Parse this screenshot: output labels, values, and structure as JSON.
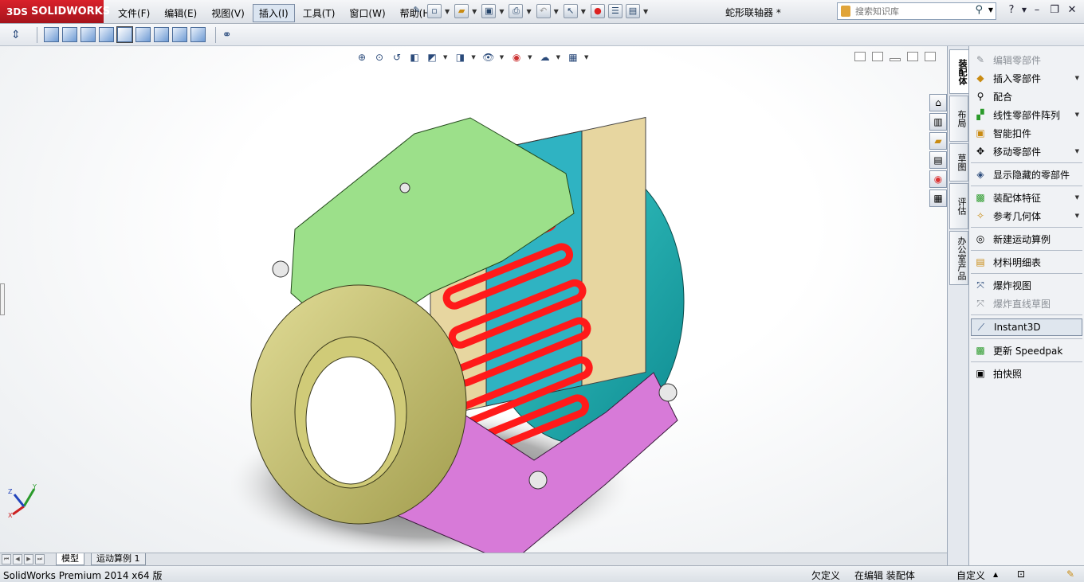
{
  "app": {
    "logo_ds": "3DS",
    "logo_text": "SOLIDWORKS",
    "document_title": "蛇形联轴器 *"
  },
  "menu": [
    "文件(F)",
    "编辑(E)",
    "视图(V)",
    "插入(I)",
    "工具(T)",
    "窗口(W)",
    "帮助(H)"
  ],
  "menu_active_index": 3,
  "search": {
    "placeholder": "搜索知识库"
  },
  "task_pane_icons": [
    "home-icon",
    "resources-icon",
    "folder-icon",
    "view-palette-icon",
    "appearance-icon",
    "custom-properties-icon"
  ],
  "vertical_tabs": [
    "装配体",
    "布局",
    "草图",
    "评估",
    "办公室产品"
  ],
  "commands": [
    {
      "label": "编辑零部件",
      "icon": "edit-component-icon",
      "disabled": true,
      "dropdown": false
    },
    {
      "label": "插入零部件",
      "icon": "insert-component-icon",
      "disabled": false,
      "dropdown": true
    },
    {
      "label": "配合",
      "icon": "mate-icon",
      "disabled": false,
      "dropdown": false
    },
    {
      "label": "线性零部件阵列",
      "icon": "linear-pattern-icon",
      "disabled": false,
      "dropdown": true
    },
    {
      "label": "智能扣件",
      "icon": "smart-fasteners-icon",
      "disabled": false,
      "dropdown": false
    },
    {
      "label": "移动零部件",
      "icon": "move-component-icon",
      "disabled": false,
      "dropdown": true
    },
    {
      "label": "显示隐藏的零部件",
      "icon": "show-hidden-icon",
      "disabled": false,
      "dropdown": false
    },
    {
      "label": "装配体特征",
      "icon": "assembly-features-icon",
      "disabled": false,
      "dropdown": true
    },
    {
      "label": "参考几何体",
      "icon": "reference-geometry-icon",
      "disabled": false,
      "dropdown": true
    },
    {
      "label": "新建运动算例",
      "icon": "new-motion-study-icon",
      "disabled": false,
      "dropdown": false
    },
    {
      "label": "材料明细表",
      "icon": "bom-icon",
      "disabled": false,
      "dropdown": false
    },
    {
      "label": "爆炸视图",
      "icon": "exploded-view-icon",
      "disabled": false,
      "dropdown": false
    },
    {
      "label": "爆炸直线草图",
      "icon": "explode-line-sketch-icon",
      "disabled": true,
      "dropdown": false
    },
    {
      "label": "Instant3D",
      "icon": "instant3d-icon",
      "disabled": false,
      "dropdown": false,
      "active": true
    },
    {
      "label": "更新 Speedpak",
      "icon": "update-speedpak-icon",
      "disabled": false,
      "dropdown": false
    },
    {
      "label": "拍快照",
      "icon": "snapshot-icon",
      "disabled": false,
      "dropdown": false
    }
  ],
  "bottom_tabs": [
    "模型",
    "运动算例 1"
  ],
  "status": {
    "product": "SolidWorks Premium 2014 x64 版",
    "definition": "欠定义",
    "mode": "在编辑 装配体",
    "custom": "自定义"
  },
  "triad": {
    "x": "X",
    "y": "Y",
    "z": "Z"
  },
  "colors": {
    "hub_front": "#c9c57a",
    "cover_top": "#9ce08a",
    "cover_bottom": "#d77ad8",
    "hub_back": "#1fb7b7",
    "grid_spring": "#ff1a1a",
    "brand_red": "#c8202a"
  }
}
